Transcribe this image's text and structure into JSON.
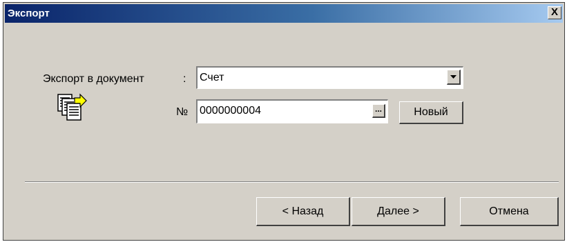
{
  "window": {
    "title": "Экспорт",
    "close_label": "X"
  },
  "form": {
    "export_label": "Экспорт в документ",
    "colon": ":",
    "document_value": "Счет",
    "number_label": "№",
    "number_value": "0000000004",
    "ellipsis_label": "...",
    "new_button_label": "Новый"
  },
  "footer": {
    "back_label": "< Назад",
    "next_label": "Далее >",
    "cancel_label": "Отмена"
  },
  "icons": {
    "export_icon": "document-export-icon",
    "dropdown_icon": "chevron-down-icon",
    "close_icon": "close-icon"
  }
}
